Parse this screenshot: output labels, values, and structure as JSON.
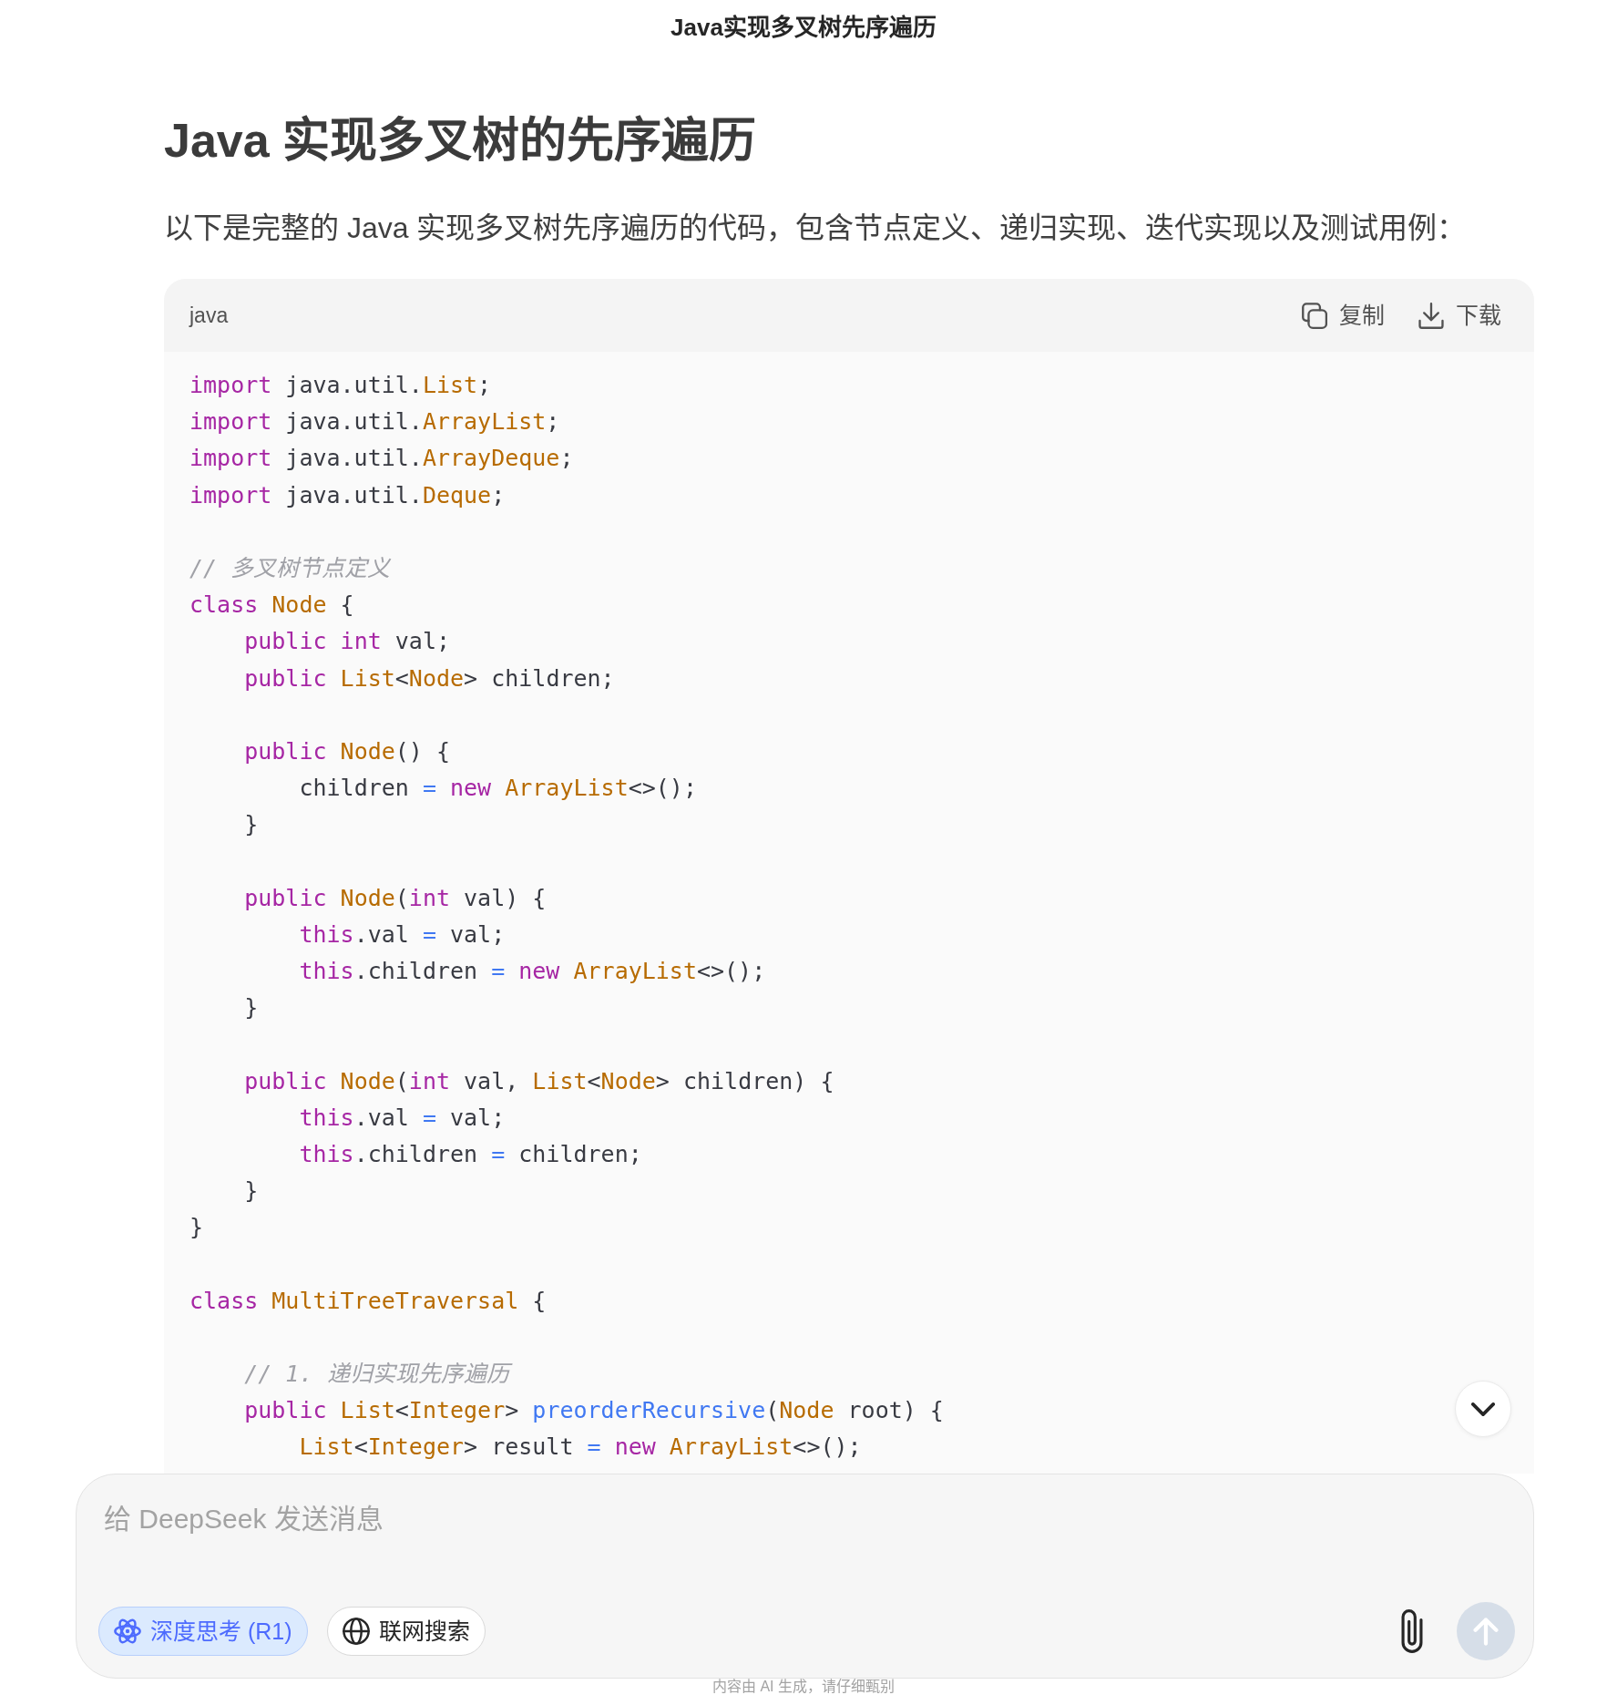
{
  "header": {
    "title": "Java实现多叉树先序遍历"
  },
  "article": {
    "heading": "Java 实现多叉树的先序遍历",
    "intro": "以下是完整的 Java 实现多叉树先序遍历的代码，包含节点定义、递归实现、迭代实现以及测试用例："
  },
  "code_block": {
    "language": "java",
    "actions": [
      {
        "label": "复制"
      },
      {
        "label": "下载"
      }
    ],
    "lines": [
      {
        "kind": "code",
        "tokens": [
          {
            "kind": "keyword",
            "text": "import"
          },
          {
            "kind": "plain",
            "text": " java.util."
          },
          {
            "kind": "type",
            "text": "List"
          },
          {
            "kind": "plain",
            "text": ";"
          }
        ]
      },
      {
        "kind": "code",
        "tokens": [
          {
            "kind": "keyword",
            "text": "import"
          },
          {
            "kind": "plain",
            "text": " java.util."
          },
          {
            "kind": "type",
            "text": "ArrayList"
          },
          {
            "kind": "plain",
            "text": ";"
          }
        ]
      },
      {
        "kind": "code",
        "tokens": [
          {
            "kind": "keyword",
            "text": "import"
          },
          {
            "kind": "plain",
            "text": " java.util."
          },
          {
            "kind": "type",
            "text": "ArrayDeque"
          },
          {
            "kind": "plain",
            "text": ";"
          }
        ]
      },
      {
        "kind": "code",
        "tokens": [
          {
            "kind": "keyword",
            "text": "import"
          },
          {
            "kind": "plain",
            "text": " java.util."
          },
          {
            "kind": "type",
            "text": "Deque"
          },
          {
            "kind": "plain",
            "text": ";"
          }
        ]
      },
      {
        "kind": "blank"
      },
      {
        "kind": "code",
        "tokens": [
          {
            "kind": "comment",
            "text": "// 多叉树节点定义"
          }
        ]
      },
      {
        "kind": "code",
        "tokens": [
          {
            "kind": "keyword",
            "text": "class "
          },
          {
            "kind": "type",
            "text": "Node"
          },
          {
            "kind": "plain",
            "text": " {"
          }
        ]
      },
      {
        "kind": "code",
        "tokens": [
          {
            "kind": "keyword",
            "text": "    public int "
          },
          {
            "kind": "plain",
            "text": "val;"
          }
        ]
      },
      {
        "kind": "code",
        "tokens": [
          {
            "kind": "keyword",
            "text": "    public "
          },
          {
            "kind": "type",
            "text": "List"
          },
          {
            "kind": "plain",
            "text": "<"
          },
          {
            "kind": "type",
            "text": "Node"
          },
          {
            "kind": "plain",
            "text": "> children;"
          }
        ]
      },
      {
        "kind": "blank"
      },
      {
        "kind": "code",
        "tokens": [
          {
            "kind": "keyword",
            "text": "    public "
          },
          {
            "kind": "type",
            "text": "Node"
          },
          {
            "kind": "plain",
            "text": "() {"
          }
        ]
      },
      {
        "kind": "code",
        "tokens": [
          {
            "kind": "plain",
            "text": "        children "
          },
          {
            "kind": "operator",
            "text": "="
          },
          {
            "kind": "keyword",
            "text": " new "
          },
          {
            "kind": "type",
            "text": "ArrayList"
          },
          {
            "kind": "plain",
            "text": "<>();"
          }
        ]
      },
      {
        "kind": "code",
        "tokens": [
          {
            "kind": "plain",
            "text": "    }"
          }
        ]
      },
      {
        "kind": "blank"
      },
      {
        "kind": "code",
        "tokens": [
          {
            "kind": "keyword",
            "text": "    public "
          },
          {
            "kind": "type",
            "text": "Node"
          },
          {
            "kind": "plain",
            "text": "("
          },
          {
            "kind": "keyword",
            "text": "int"
          },
          {
            "kind": "plain",
            "text": " val) {"
          }
        ]
      },
      {
        "kind": "code",
        "tokens": [
          {
            "kind": "keyword",
            "text": "        this"
          },
          {
            "kind": "plain",
            "text": ".val "
          },
          {
            "kind": "operator",
            "text": "="
          },
          {
            "kind": "plain",
            "text": " val;"
          }
        ]
      },
      {
        "kind": "code",
        "tokens": [
          {
            "kind": "keyword",
            "text": "        this"
          },
          {
            "kind": "plain",
            "text": ".children "
          },
          {
            "kind": "operator",
            "text": "="
          },
          {
            "kind": "keyword",
            "text": " new "
          },
          {
            "kind": "type",
            "text": "ArrayList"
          },
          {
            "kind": "plain",
            "text": "<>();"
          }
        ]
      },
      {
        "kind": "code",
        "tokens": [
          {
            "kind": "plain",
            "text": "    }"
          }
        ]
      },
      {
        "kind": "blank"
      },
      {
        "kind": "code",
        "tokens": [
          {
            "kind": "keyword",
            "text": "    public "
          },
          {
            "kind": "type",
            "text": "Node"
          },
          {
            "kind": "plain",
            "text": "("
          },
          {
            "kind": "keyword",
            "text": "int"
          },
          {
            "kind": "plain",
            "text": " val, "
          },
          {
            "kind": "type",
            "text": "List"
          },
          {
            "kind": "plain",
            "text": "<"
          },
          {
            "kind": "type",
            "text": "Node"
          },
          {
            "kind": "plain",
            "text": "> children) {"
          }
        ]
      },
      {
        "kind": "code",
        "tokens": [
          {
            "kind": "keyword",
            "text": "        this"
          },
          {
            "kind": "plain",
            "text": ".val "
          },
          {
            "kind": "operator",
            "text": "="
          },
          {
            "kind": "plain",
            "text": " val;"
          }
        ]
      },
      {
        "kind": "code",
        "tokens": [
          {
            "kind": "keyword",
            "text": "        this"
          },
          {
            "kind": "plain",
            "text": ".children "
          },
          {
            "kind": "operator",
            "text": "="
          },
          {
            "kind": "plain",
            "text": " children;"
          }
        ]
      },
      {
        "kind": "code",
        "tokens": [
          {
            "kind": "plain",
            "text": "    }"
          }
        ]
      },
      {
        "kind": "code",
        "tokens": [
          {
            "kind": "plain",
            "text": "}"
          }
        ]
      },
      {
        "kind": "blank"
      },
      {
        "kind": "code",
        "tokens": [
          {
            "kind": "keyword",
            "text": "class "
          },
          {
            "kind": "type",
            "text": "MultiTreeTraversal"
          },
          {
            "kind": "plain",
            "text": " {"
          }
        ]
      },
      {
        "kind": "blank"
      },
      {
        "kind": "code",
        "tokens": [
          {
            "kind": "comment",
            "text": "    // 1. 递归实现先序遍历"
          }
        ]
      },
      {
        "kind": "code",
        "tokens": [
          {
            "kind": "keyword",
            "text": "    public "
          },
          {
            "kind": "type",
            "text": "List"
          },
          {
            "kind": "plain",
            "text": "<"
          },
          {
            "kind": "type",
            "text": "Integer"
          },
          {
            "kind": "plain",
            "text": "> "
          },
          {
            "kind": "function",
            "text": "preorderRecursive"
          },
          {
            "kind": "plain",
            "text": "("
          },
          {
            "kind": "type",
            "text": "Node"
          },
          {
            "kind": "plain",
            "text": " root) {"
          }
        ]
      },
      {
        "kind": "code",
        "tokens": [
          {
            "kind": "type",
            "text": "        List"
          },
          {
            "kind": "plain",
            "text": "<"
          },
          {
            "kind": "type",
            "text": "Integer"
          },
          {
            "kind": "plain",
            "text": "> result "
          },
          {
            "kind": "operator",
            "text": "="
          },
          {
            "kind": "keyword",
            "text": " new "
          },
          {
            "kind": "type",
            "text": "ArrayList"
          },
          {
            "kind": "plain",
            "text": "<>();"
          }
        ]
      }
    ]
  },
  "composer": {
    "placeholder": "给 DeepSeek 发送消息",
    "toggles": [
      {
        "label": "深度思考 (R1)",
        "selected": true
      },
      {
        "label": "联网搜索",
        "selected": false
      }
    ],
    "send": {
      "disabled": true
    }
  },
  "footer_note": "内容由 AI 生成，请仔细甄别"
}
